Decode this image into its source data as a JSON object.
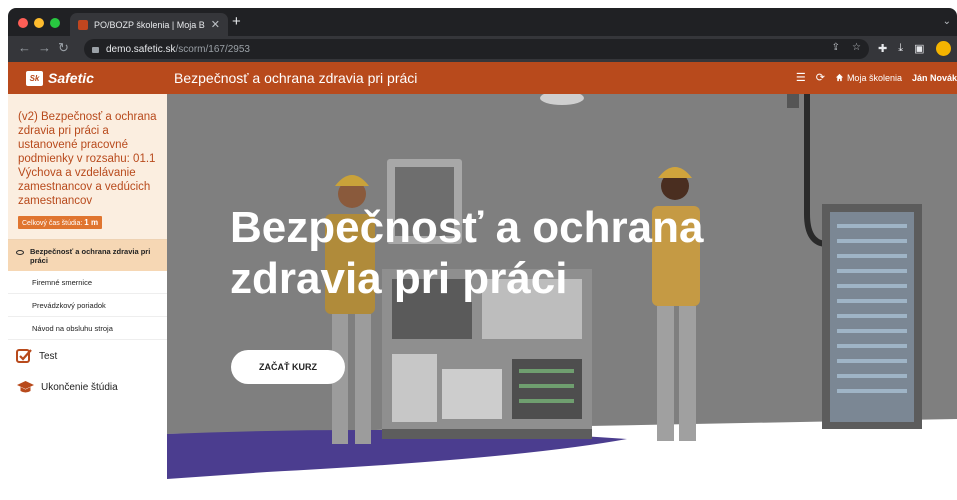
{
  "browser": {
    "tab_title": "PO/BOZP školenia | Moja BOZP",
    "new_tab_symbol": "+",
    "url_host": "demo.safetic.sk",
    "url_path": "/scorm/167/2953"
  },
  "header": {
    "logo_badge": "Sk",
    "logo_text": "Safetic",
    "course_title": "Bezpečnosť a ochrana zdravia pri práci",
    "my_trainings": "Moja školenia",
    "user_name": "Ján Novák"
  },
  "sidebar": {
    "course_name": "(v2) Bezpečnosť a ochrana zdravia pri práci a ustanovené pracovné podmienky v rozsahu: 01.1 Výchova a vzdelávanie zamestnancov a vedúcich zamestnancov",
    "study_time_label": "Celkový čas štúdia:",
    "study_time_value": "1 m",
    "active_item": "Bezpečnosť a ochrana zdravia pri práci",
    "sub_items": [
      "Firemné smernice",
      "Prevádzkový poriadok",
      "Návod na obsluhu stroja"
    ],
    "test_label": "Test",
    "finish_label": "Ukončenie štúdia"
  },
  "hero": {
    "title_line1": "Bezpečnosť a ochrana",
    "title_line2": "zdravia pri práci",
    "start_button": "ZAČAŤ KURZ"
  },
  "colors": {
    "brand": "#b84a1c",
    "sidebar_bg": "#fbeee0",
    "active_item_bg": "#f6d7b4",
    "accent_orange": "#e0752f",
    "floor_purple": "#4b3d8f"
  },
  "icons": [
    "search-icon",
    "back-icon",
    "forward-icon",
    "reload-icon",
    "menu-icon",
    "refresh-icon",
    "home-icon",
    "eye-icon",
    "checkbox-icon",
    "graduation-cap-icon"
  ]
}
